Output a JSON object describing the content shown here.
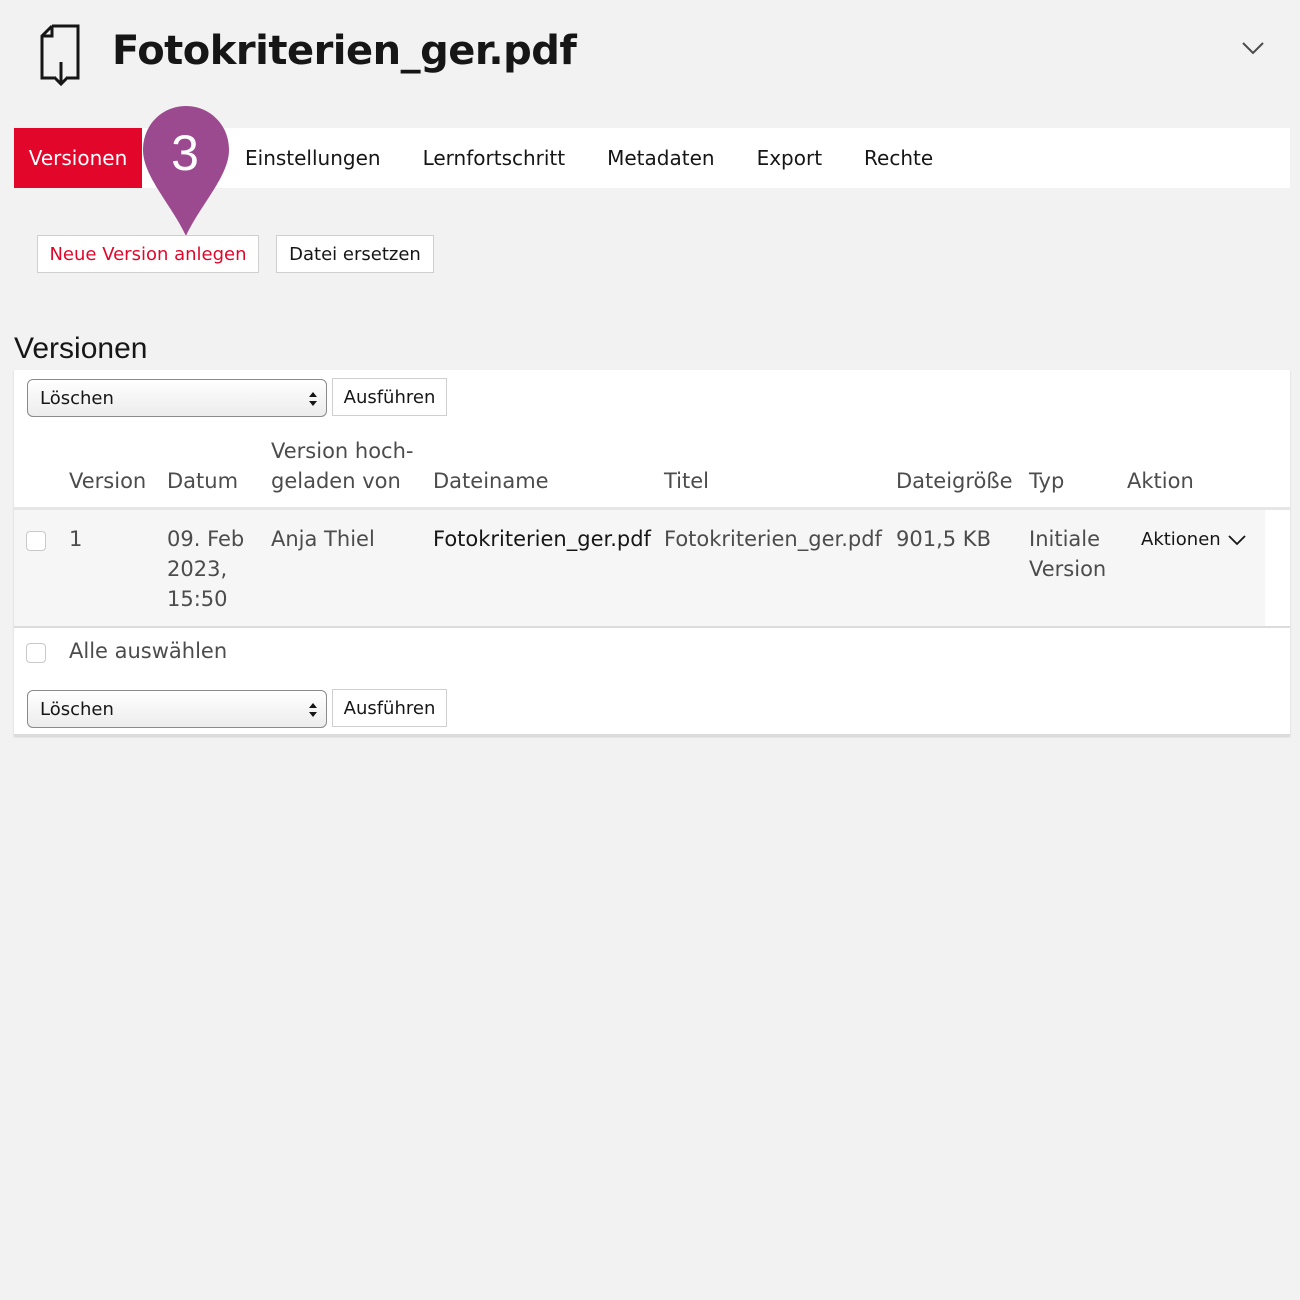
{
  "header": {
    "title": "Fotokriterien_ger.pdf",
    "icon": "file-download-icon"
  },
  "tabs": [
    {
      "label": "Versionen",
      "active": true
    },
    {
      "label": "Einstellungen",
      "active": false
    },
    {
      "label": "Lernfortschritt",
      "active": false
    },
    {
      "label": "Metadaten",
      "active": false
    },
    {
      "label": "Export",
      "active": false
    },
    {
      "label": "Rechte",
      "active": false
    }
  ],
  "marker": {
    "number": "3",
    "color": "#9c4a8f"
  },
  "toolbar": {
    "new_version_label": "Neue Version anlegen",
    "replace_file_label": "Datei ersetzen"
  },
  "section": {
    "title": "Versionen"
  },
  "bulk_top": {
    "select_value": "Löschen",
    "execute_label": "Ausführen"
  },
  "bulk_bottom": {
    "select_value": "Löschen",
    "execute_label": "Ausführen"
  },
  "table": {
    "columns": {
      "version": "Version",
      "date": "Datum",
      "uploaded_by_line1": "Version hoch-",
      "uploaded_by_line2": "geladen von",
      "filename": "Dateiname",
      "title": "Titel",
      "size": "Dateigröße",
      "type": "Typ",
      "action": "Aktion"
    },
    "rows": [
      {
        "version": "1",
        "date_line1": "09. Feb",
        "date_line2": "2023,",
        "date_line3": "15:50",
        "uploaded_by": "Anja Thiel",
        "filename": "Fotokriterien_ger.pdf",
        "title": "Fotokriterien_ger.pdf",
        "size": "901,5 KB",
        "type_line1": "Initiale",
        "type_line2": "Version",
        "action_label": "Aktionen"
      }
    ],
    "select_all_label": "Alle auswählen"
  },
  "colors": {
    "accent": "#e2062b",
    "background": "#f2f2f2"
  }
}
